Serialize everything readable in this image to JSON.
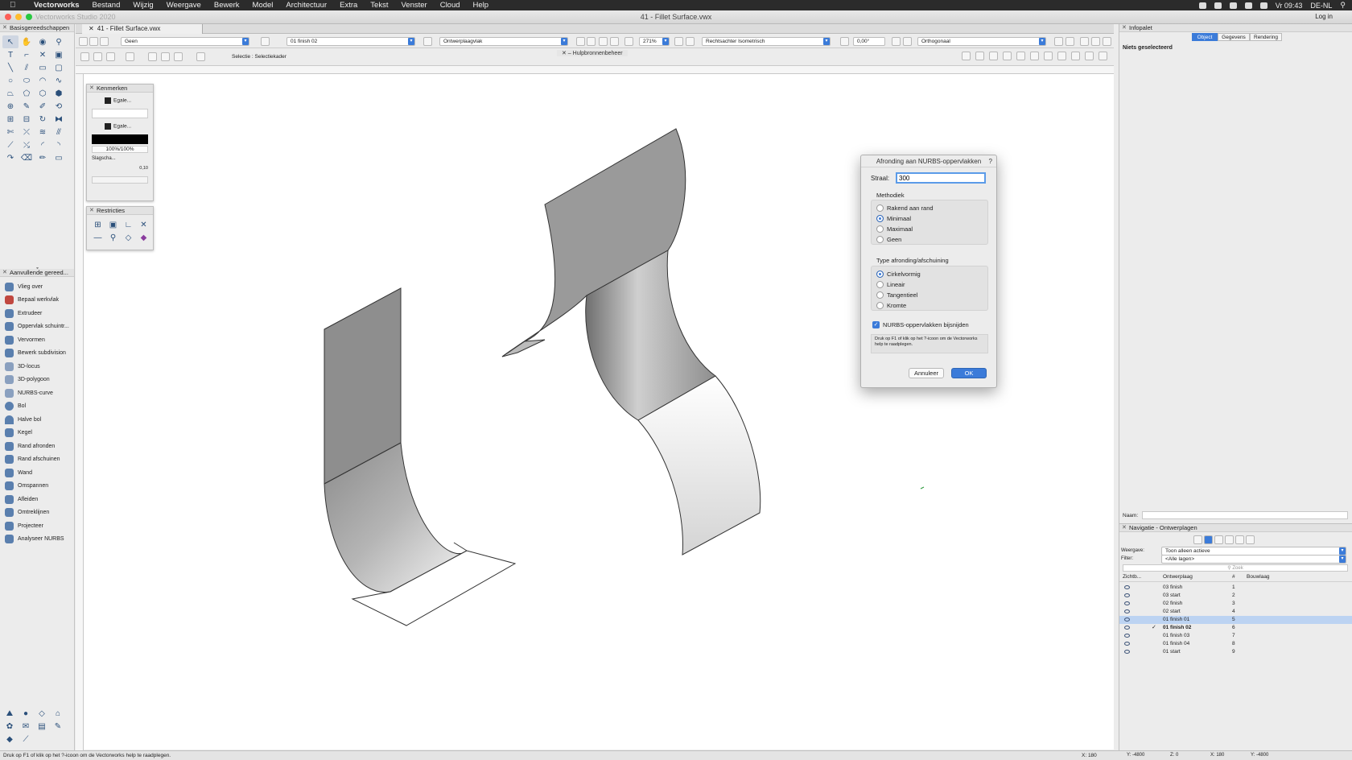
{
  "menubar": {
    "app": "Vectorworks",
    "items": [
      "Bestand",
      "Wijzig",
      "Weergave",
      "Bewerk",
      "Model",
      "Architectuur",
      "Extra",
      "Tekst",
      "Venster",
      "Cloud",
      "Help"
    ],
    "clock": "Vr 09:43",
    "locale": "DE-NL",
    "login": "Log in"
  },
  "window": {
    "title": "41 - Fillet Surface.vwx",
    "ghost_title": "Vectorworks Studio 2020",
    "tab": "41 - Fillet Surface.vwx"
  },
  "toolbox": {
    "basic_title": "Basisgereedschappen",
    "extra_title": "Aanvullende gereed...",
    "extra_items": [
      "Vlieg over",
      "Bepaal werkvlak",
      "Extrudeer",
      "Oppervlak schuintr...",
      "Vervormen",
      "Bewerk subdivision",
      "3D-locus",
      "3D-polygoon",
      "NURBS-curve",
      "Bol",
      "Halve bol",
      "Kegel",
      "Rand afronden",
      "Rand afschuinen",
      "Wand",
      "Omspannen",
      "Afleiden",
      "Omtreklijnen",
      "Projecteer",
      "Analyseer NURBS"
    ]
  },
  "viewbar": {
    "class_value": "Geen",
    "layer_value": "01 finish 02",
    "plane_value": "Ontwerplaagvlak",
    "zoom_value": "271%",
    "view_value": "Rechtsachter Isometrisch",
    "angle_value": "0,00°",
    "projection_value": "Orthogonaal"
  },
  "modebar": {
    "mode_label": "Selectie : Selectiekader",
    "resource_tab": "Hulpbronnenbeheer"
  },
  "attributes": {
    "title": "Kenmerken",
    "fill_label": "Egale...",
    "pen_label": "Egale...",
    "opacity": "100%/100%",
    "shadow_label": "Slagscha...",
    "line_weight": "0,10"
  },
  "constraints": {
    "title": "Restricties"
  },
  "dialog": {
    "title": "Afronding aan NURBS-oppervlakken",
    "help": "?",
    "radius_label": "Straal:",
    "radius_value": "300",
    "method_title": "Methodiek",
    "methods": [
      "Rakend aan rand",
      "Minimaal",
      "Maximaal",
      "Geen"
    ],
    "method_selected": 1,
    "type_title": "Type afronding/afschuining",
    "types": [
      "Cirkelvormig",
      "Lineair",
      "Tangentieel",
      "Kromte"
    ],
    "type_selected": 0,
    "trim_label": "NURBS-oppervlakken bijsnijden",
    "trim_checked": true,
    "help_text": "Druk op F1 of klik op het ?-icoon om de Vectorworks help te raadplegen.",
    "cancel": "Annuleer",
    "ok": "OK"
  },
  "infopalet": {
    "title": "Infopalet",
    "tabs": [
      "Object",
      "Gegevens",
      "Rendering"
    ],
    "active_tab": 0,
    "status": "Niets geselecteerd",
    "name_label": "Naam:"
  },
  "navigation": {
    "title": "Navigatie - Ontwerplagen",
    "display_label": "Weergave:",
    "display_value": "Toon alleen actieve",
    "filter_label": "Filter:",
    "filter_value": "<Alle lagen>",
    "search_placeholder": "Zoek",
    "columns": [
      "Zichtb...",
      "Ontwerplaag",
      "#",
      "Bouwlaag"
    ],
    "rows": [
      {
        "name": "03 finish",
        "num": "1"
      },
      {
        "name": "03 start",
        "num": "2"
      },
      {
        "name": "02 finish",
        "num": "3"
      },
      {
        "name": "02 start",
        "num": "4"
      },
      {
        "name": "01 finish 01",
        "num": "5"
      },
      {
        "name": "01 finish 02",
        "num": "6"
      },
      {
        "name": "01 finish 03",
        "num": "7"
      },
      {
        "name": "01 finish 04",
        "num": "8"
      },
      {
        "name": "01 start",
        "num": "9"
      }
    ],
    "highlight_row": 4,
    "active_row": 5
  },
  "statusbar": {
    "hint": "Druk op F1 of klik op het ?-icoon om de Vectorworks help te raadplegen.",
    "x1": "X: 180",
    "y1": "Y: -4800",
    "z1": "Z: 0",
    "x2": "X: 180",
    "y2": "Y: -4800"
  },
  "colors": {
    "accent": "#3b7bd9",
    "menubar": "#2b2b2b",
    "selection_row": "#bcd3f2"
  }
}
